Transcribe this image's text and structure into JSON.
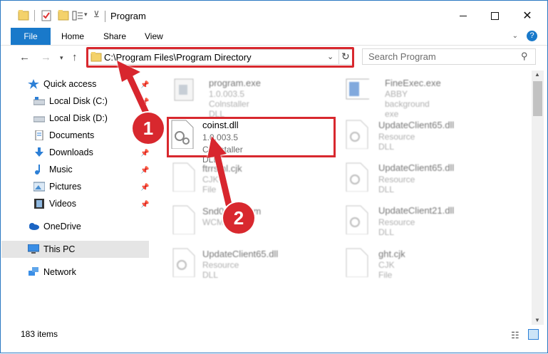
{
  "window": {
    "title": "Program"
  },
  "ribbon": {
    "tabs": [
      "File",
      "Home",
      "Share",
      "View"
    ]
  },
  "address": {
    "path": "C:\\Program Files\\Program Directory"
  },
  "search": {
    "placeholder": "Search Program"
  },
  "sidebar": {
    "items": [
      {
        "label": "Quick access",
        "icon": "star-icon"
      },
      {
        "label": "Local Disk (C:)",
        "icon": "drive-icon"
      },
      {
        "label": "Local Disk (D:)",
        "icon": "drive-icon"
      },
      {
        "label": "Documents",
        "icon": "documents-icon"
      },
      {
        "label": "Downloads",
        "icon": "download-icon"
      },
      {
        "label": "Music",
        "icon": "music-icon"
      },
      {
        "label": "Pictures",
        "icon": "pictures-icon"
      },
      {
        "label": "Videos",
        "icon": "videos-icon"
      },
      {
        "label": "OneDrive",
        "icon": "cloud-icon"
      },
      {
        "label": "This PC",
        "icon": "computer-icon"
      },
      {
        "label": "Network",
        "icon": "network-icon"
      }
    ]
  },
  "files": [
    {
      "name": "program.exe",
      "version": "1.0.003.5",
      "description": "Colnstaller DLL"
    },
    {
      "name": "FineExec.exe",
      "version": "",
      "description": "ABBY background exe"
    },
    {
      "name": "coinst.dll",
      "version": "1.0.003.5",
      "description": "Colnstaller DLL"
    },
    {
      "name": "UpdateClient65.dll",
      "version": "",
      "description": "Resource DLL"
    },
    {
      "name": "ftrrsml.cjk",
      "version": "",
      "description": "CJK File"
    },
    {
      "name": "UpdateClient65.dll",
      "version": "",
      "description": "Resource DLL"
    },
    {
      "name": "Snd0004.wcm",
      "version": "",
      "description": "WCM"
    },
    {
      "name": "UpdateClient21.dll",
      "version": "",
      "description": "Resource DLL"
    },
    {
      "name": "UpdateClient65.dll",
      "version": "",
      "description": "Resource DLL"
    },
    {
      "name": "ght.cjk",
      "version": "",
      "description": "CJK File"
    }
  ],
  "status": {
    "item_count": "183 items"
  },
  "annotations": {
    "step1": "1",
    "step2": "2",
    "color": "#d8282e"
  }
}
